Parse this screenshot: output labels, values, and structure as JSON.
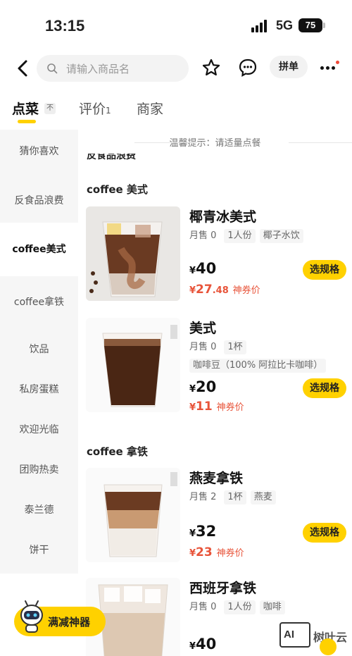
{
  "status": {
    "time": "13:15",
    "network": "5G",
    "battery": "75"
  },
  "topbar": {
    "search_placeholder": "请输入商品名",
    "pindan_label": "拼单"
  },
  "tabs": [
    {
      "label": "点菜"
    },
    {
      "label": "评价",
      "count": "1"
    },
    {
      "label": "商家"
    }
  ],
  "sort_icon": "不",
  "sidebar": {
    "items": [
      {
        "label": "猜你喜欢"
      },
      {
        "label": "反食品浪费"
      },
      {
        "label": "coffee美式"
      },
      {
        "label": "coffee拿铁"
      },
      {
        "label": "饮品"
      },
      {
        "label": "私房蛋糕"
      },
      {
        "label": "欢迎光临"
      },
      {
        "label": "团购热卖"
      },
      {
        "label": "泰兰德"
      },
      {
        "label": "饼干"
      }
    ]
  },
  "content": {
    "tip": "温馨提示：请适量点餐",
    "cut_category": "反食品浪费",
    "categories": [
      "coffee 美式",
      "coffee 拿铁"
    ],
    "products": [
      {
        "name": "椰青冰美式",
        "sales": "月售 0",
        "tags": [
          "1人份",
          "椰子水饮"
        ],
        "price_symbol": "¥",
        "price": "40",
        "coupon_int": "27",
        "coupon_dec": ".48",
        "coupon_label": "神券价",
        "spec": "选规格"
      },
      {
        "name": "美式",
        "sales": "月售 0",
        "tags": [
          "1杯",
          "咖啡豆（100% 阿拉比卡咖啡）"
        ],
        "price_symbol": "¥",
        "price": "20",
        "coupon_int": "11",
        "coupon_dec": "",
        "coupon_label": "神券价",
        "spec": "选规格"
      },
      {
        "name": "燕麦拿铁",
        "sales": "月售 2",
        "tags": [
          "1杯",
          "燕麦"
        ],
        "price_symbol": "¥",
        "price": "32",
        "coupon_int": "23",
        "coupon_dec": "",
        "coupon_label": "神券价",
        "spec": "选规格"
      },
      {
        "name": "西班牙拿铁",
        "sales": "月售 0",
        "tags": [
          "1人份",
          "咖啡"
        ],
        "price_symbol": "¥",
        "price": "40"
      }
    ],
    "coupon_symbol": "¥"
  },
  "floating": {
    "promo_label": "满减神器",
    "watermark_logo": "AI",
    "watermark_text": "树叶云"
  },
  "colors": {
    "accent": "#ffd100",
    "coupon": "#e8543a"
  }
}
